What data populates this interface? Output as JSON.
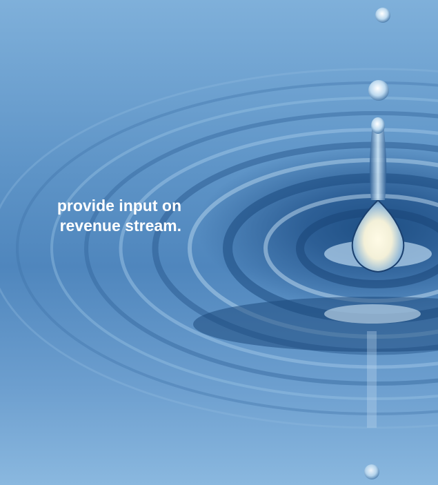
{
  "slide": {
    "text_lines": [
      "provide input on",
      "revenue stream."
    ]
  },
  "colors": {
    "sky_top": "#7fb0da",
    "water_mid": "#4f86bd",
    "ring_dark": "#1e4f84",
    "text": "#ffffff"
  },
  "icons": {
    "background": "water-droplet-splash-photo"
  }
}
